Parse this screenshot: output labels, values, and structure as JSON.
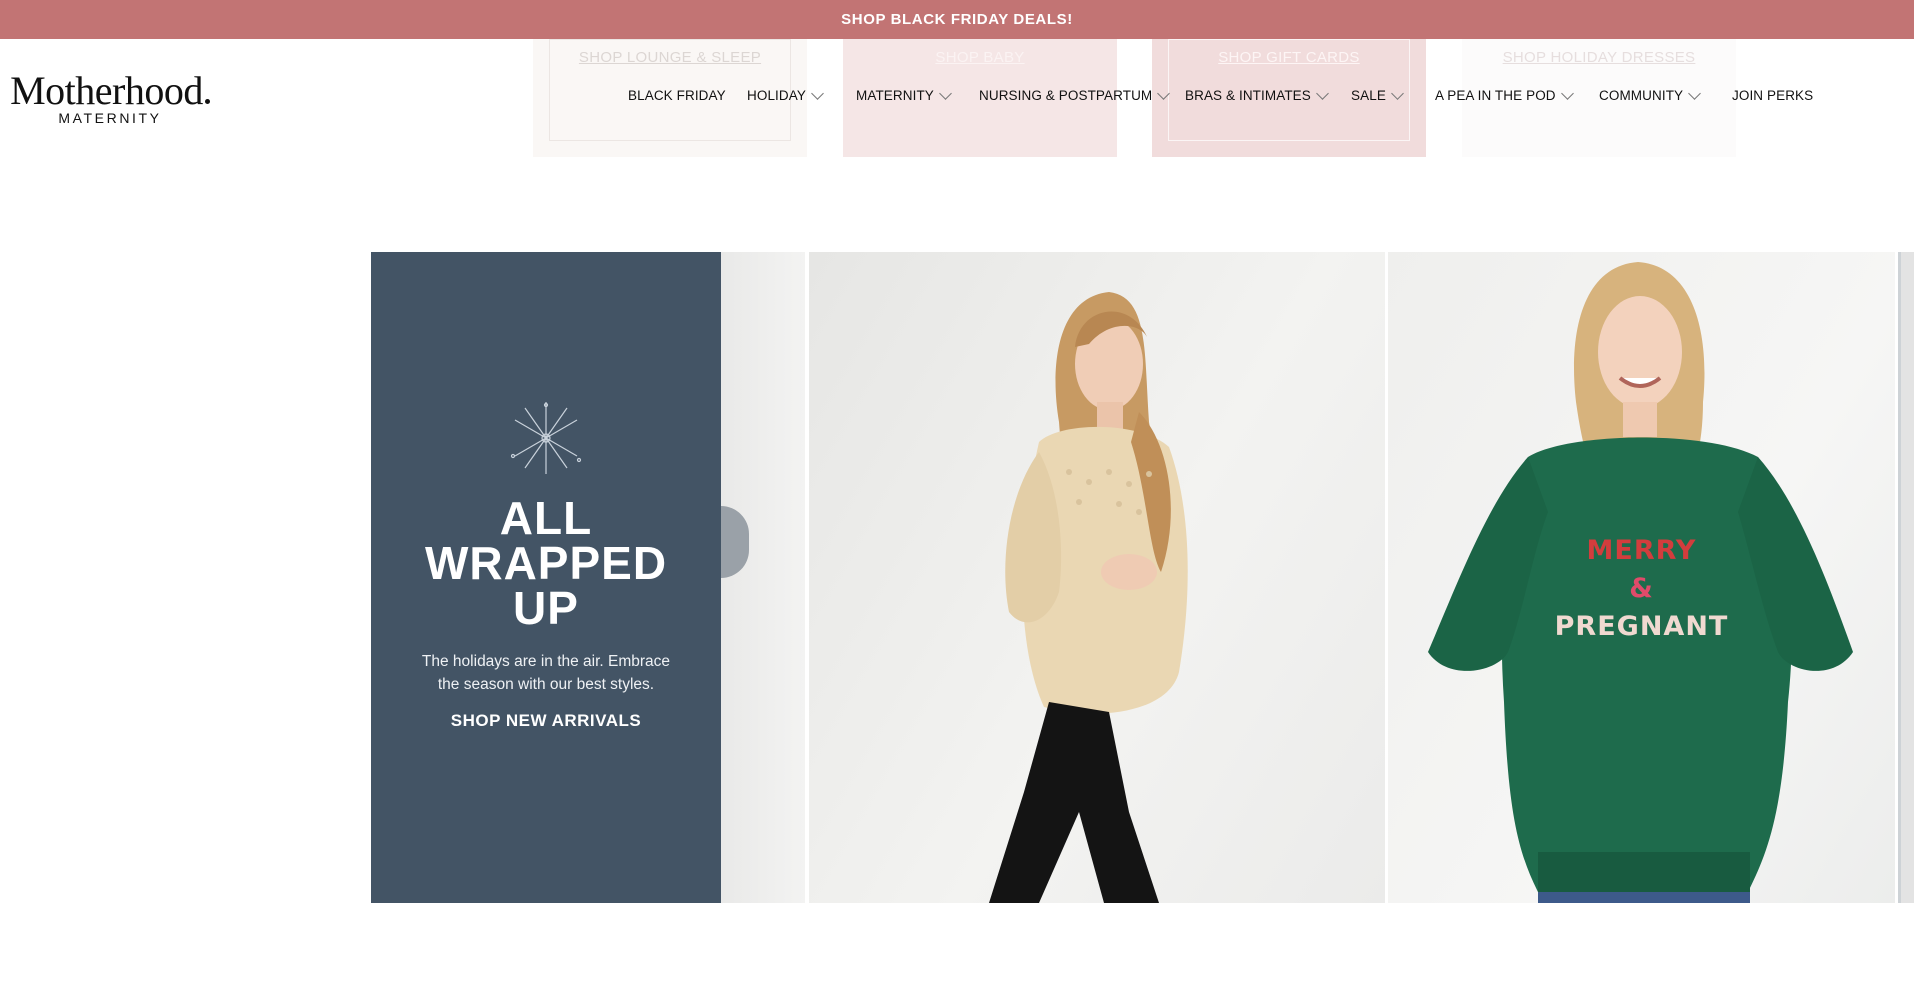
{
  "promo_bar": {
    "text": "SHOP BLACK FRIDAY DEALS!",
    "color": "#c27474"
  },
  "category_tiles": [
    {
      "label": "SHOP LOUNGE & SLEEP"
    },
    {
      "label": "SHOP BABY"
    },
    {
      "label": "SHOP GIFT CARDS"
    },
    {
      "label": "SHOP HOLIDAY DRESSES"
    }
  ],
  "logo": {
    "brand": "Motherhood",
    "sub": "MATERNITY"
  },
  "nav": {
    "items": [
      {
        "label": "BLACK FRIDAY",
        "dropdown": false
      },
      {
        "label": "HOLIDAY",
        "dropdown": true
      },
      {
        "label": "MATERNITY",
        "dropdown": true
      },
      {
        "label": "NURSING & POSTPARTUM",
        "dropdown": true
      },
      {
        "label": "BRAS & INTIMATES",
        "dropdown": true
      },
      {
        "label": "SALE",
        "dropdown": true
      },
      {
        "label": "A PEA IN THE POD",
        "dropdown": true
      },
      {
        "label": "COMMUNITY",
        "dropdown": true
      },
      {
        "label": "JOIN PERKS",
        "dropdown": false
      }
    ]
  },
  "hero": {
    "headline_line1": "ALL",
    "headline_line2": "WRAPPED",
    "headline_line3": "UP",
    "description": "The holidays are in the air. Embrace the season with our best styles.",
    "cta": "SHOP NEW ARRIVALS",
    "panel_color": "#435465",
    "icon": "snowflake-icon"
  },
  "products": {
    "sweater_print_line1": "MERRY",
    "sweater_print_line2": "&",
    "sweater_print_line3": "PREGNANT"
  }
}
